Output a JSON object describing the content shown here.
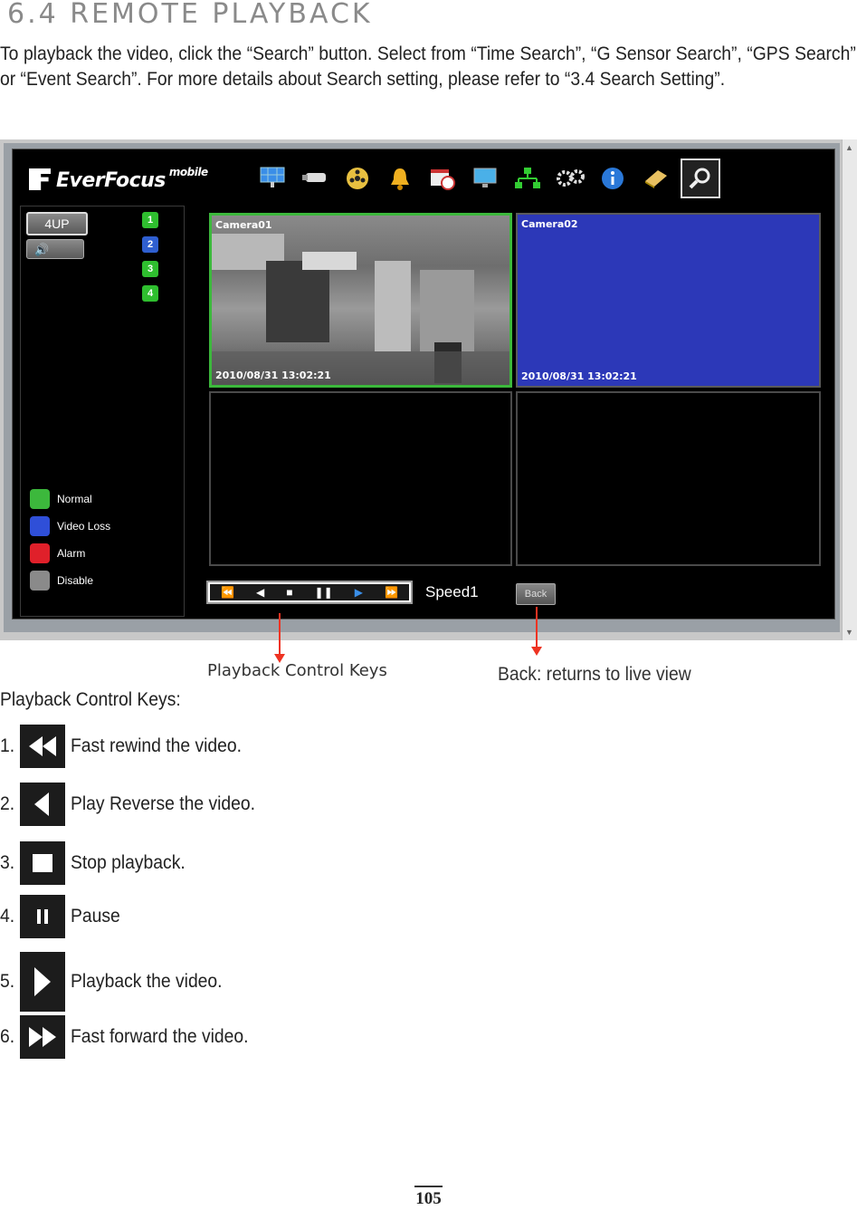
{
  "heading": "6.4  REMOTE PLAYBACK",
  "intro": "To playback the video, click the “Search” button. Select from “Time Search”, “G Sensor Search”, “GPS Search” or “Event Search”.  For more details about Search setting, please refer to “3.4 Search Setting”.",
  "app": {
    "logo": "EverFocus",
    "logo_sup": "mobile",
    "toolbar": [
      "monitor-icon",
      "camera-icon",
      "film-reel-icon",
      "alarm-bell-icon",
      "schedule-icon",
      "display-icon",
      "network-icon",
      "gears-icon",
      "info-icon",
      "notebook-icon",
      "search-icon"
    ],
    "sidebar": {
      "layout_button": "4UP",
      "channels": [
        "1",
        "2",
        "3",
        "4"
      ],
      "channel_colors": [
        "#2fbf2f",
        "#2f5fd0",
        "#2fbf2f",
        "#2fbf2f"
      ],
      "legend": [
        {
          "label": "Normal",
          "color": "#3cb83c"
        },
        {
          "label": "Video Loss",
          "color": "#2f4fd8"
        },
        {
          "label": "Alarm",
          "color": "#e0202a"
        },
        {
          "label": "Disable",
          "color": "#8a8a8a"
        }
      ]
    },
    "cameras": [
      {
        "name": "Camera01",
        "timestamp": "2010/08/31  13:02:21"
      },
      {
        "name": "Camera02",
        "timestamp": "2010/08/31  13:02:21"
      }
    ],
    "controls": {
      "keys": [
        "⏪",
        "◀",
        "■",
        "❚❚",
        "▶",
        "⏩"
      ],
      "speed": "Speed1",
      "back": "Back"
    }
  },
  "callouts": {
    "playback_keys": "Playback Control Keys",
    "back": "Back: returns to live view"
  },
  "subheading": "Playback Control Keys:",
  "items": [
    {
      "num": "1.",
      "glyph": "◀◀",
      "text": "Fast rewind the video."
    },
    {
      "num": "2.",
      "glyph": "◀",
      "text": "Play Reverse the video."
    },
    {
      "num": "3.",
      "glyph": "■",
      "text": "Stop playback."
    },
    {
      "num": "4.",
      "glyph": "❚❚",
      "text": "Pause"
    },
    {
      "num": "5.",
      "glyph": "▶",
      "text": "Playback the video."
    },
    {
      "num": "6.",
      "glyph": "▶▶",
      "text": "Fast forward the video."
    }
  ],
  "page_number": "105"
}
